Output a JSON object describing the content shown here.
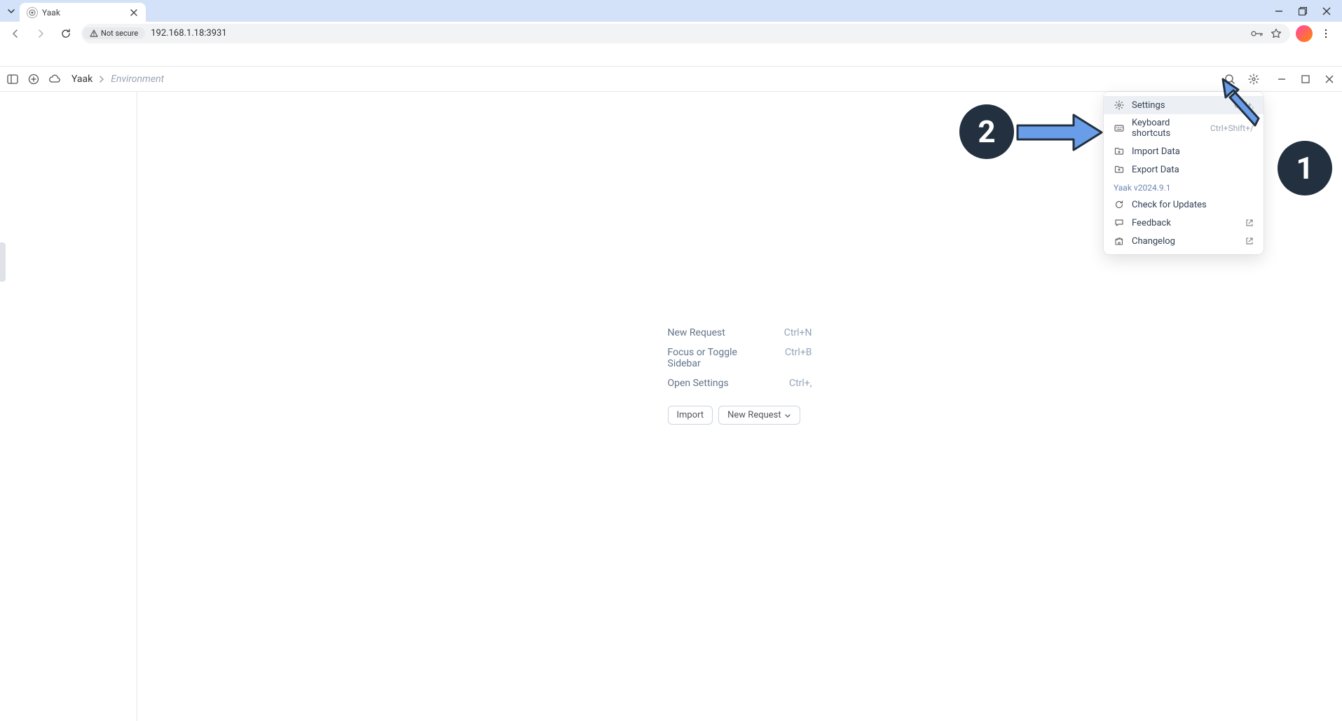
{
  "browser": {
    "tab_title": "Yaak",
    "not_secure_label": "Not secure",
    "url": "192.168.1.18:3931"
  },
  "toolbar": {
    "workspace": "Yaak",
    "environment": "Environment"
  },
  "welcome": {
    "rows": [
      {
        "label": "New Request",
        "shortcut": "Ctrl+N"
      },
      {
        "label": "Focus or Toggle Sidebar",
        "shortcut": "Ctrl+B"
      },
      {
        "label": "Open Settings",
        "shortcut": "Ctrl+,"
      }
    ],
    "import_btn": "Import",
    "new_request_btn": "New Request"
  },
  "dropdown": {
    "version": "Yaak v2024.9.1",
    "items_top": [
      {
        "label": "Settings",
        "shortcut": "Ctrl+,"
      },
      {
        "label": "Keyboard shortcuts",
        "shortcut": "Ctrl+Shift+/"
      },
      {
        "label": "Import Data",
        "shortcut": ""
      },
      {
        "label": "Export Data",
        "shortcut": ""
      }
    ],
    "items_bottom": [
      {
        "label": "Check for Updates",
        "ext": false
      },
      {
        "label": "Feedback",
        "ext": true
      },
      {
        "label": "Changelog",
        "ext": true
      }
    ]
  },
  "annotations": {
    "badge1": "1",
    "badge2": "2"
  }
}
